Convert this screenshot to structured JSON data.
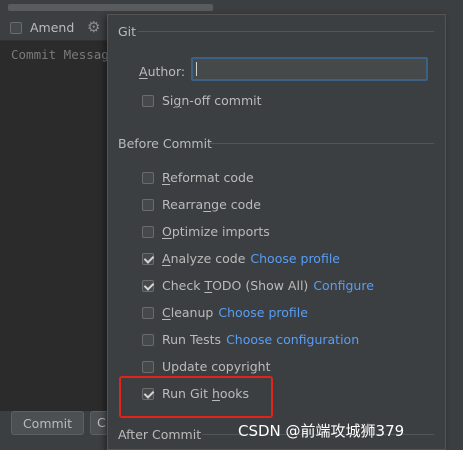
{
  "left": {
    "amend_label": "Amend",
    "commit_placeholder": "Commit Message",
    "commit_button": "Commit",
    "more_button": "C"
  },
  "popup": {
    "git_section": "Git",
    "author_label": "Author:",
    "author_value": "",
    "signoff": {
      "label": "Sign-off commit",
      "checked": false
    },
    "before_commit_section": "Before Commit",
    "before_commit": [
      {
        "label": "Reformat code",
        "checked": false,
        "link": ""
      },
      {
        "label": "Rearrange code",
        "checked": false,
        "link": ""
      },
      {
        "label": "Optimize imports",
        "checked": false,
        "link": ""
      },
      {
        "label": "Analyze code",
        "checked": true,
        "link": "Choose profile"
      },
      {
        "label": "Check TODO (Show All)",
        "checked": true,
        "link": "Configure"
      },
      {
        "label": "Cleanup",
        "checked": false,
        "link": "Choose profile"
      },
      {
        "label": "Run Tests",
        "checked": false,
        "link": "Choose configuration"
      },
      {
        "label": "Update copyright",
        "checked": false,
        "link": ""
      },
      {
        "label": "Run Git hooks",
        "checked": true,
        "link": ""
      }
    ],
    "after_commit_section": "After Commit"
  },
  "watermark": "CSDN @前端攻城狮379",
  "colors": {
    "link": "#589df6",
    "highlight": "#e3221c",
    "panel": "#3c3f41",
    "editor": "#2b2b2b"
  }
}
